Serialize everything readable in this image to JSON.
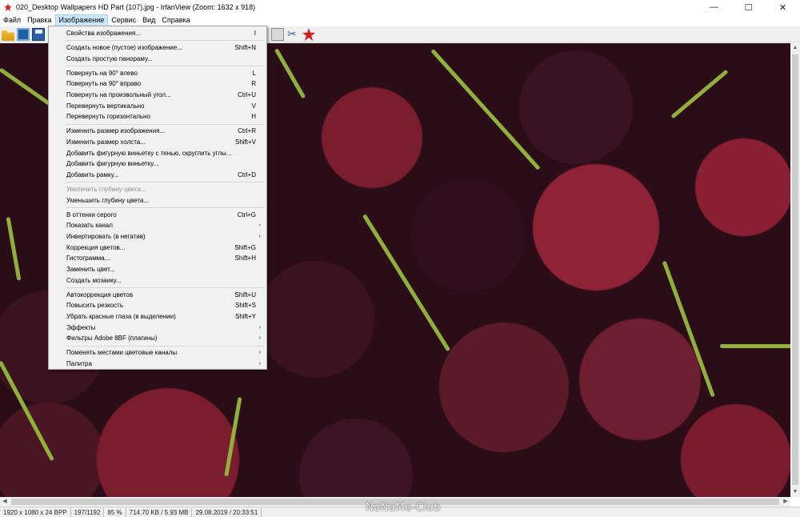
{
  "window": {
    "title": "020_Desktop Wallpapers  HD Part (107).jpg - IrfanView (Zoom: 1632 x 918)",
    "minimize": "—",
    "maximize": "☐",
    "close": "✕"
  },
  "menubar": {
    "items": [
      "Файл",
      "Правка",
      "Изображение",
      "Сервис",
      "Вид",
      "Справка"
    ]
  },
  "dropdown": {
    "items": [
      {
        "label": "Свойства изображения...",
        "shortcut": "I",
        "submenu": false,
        "disabled": false
      },
      {
        "sep": true
      },
      {
        "label": "Создать новое (пустое) изображение...",
        "shortcut": "Shift+N",
        "submenu": false,
        "disabled": false
      },
      {
        "label": "Создать простую панораму...",
        "shortcut": "",
        "submenu": false,
        "disabled": false
      },
      {
        "sep": true
      },
      {
        "label": "Повернуть на 90° влево",
        "shortcut": "L",
        "submenu": false,
        "disabled": false
      },
      {
        "label": "Повернуть на 90° вправо",
        "shortcut": "R",
        "submenu": false,
        "disabled": false
      },
      {
        "label": "Повернуть на произвольный угол...",
        "shortcut": "Ctrl+U",
        "submenu": false,
        "disabled": false
      },
      {
        "label": "Перевернуть вертикально",
        "shortcut": "V",
        "submenu": false,
        "disabled": false
      },
      {
        "label": "Перевернуть горизонтально",
        "shortcut": "H",
        "submenu": false,
        "disabled": false
      },
      {
        "sep": true
      },
      {
        "label": "Изменить размер изображения...",
        "shortcut": "Ctrl+R",
        "submenu": false,
        "disabled": false
      },
      {
        "label": "Изменить размер холста...",
        "shortcut": "Shift+V",
        "submenu": false,
        "disabled": false
      },
      {
        "label": "Добавить фигурную виньетку с тенью, скруглить углы...",
        "shortcut": "",
        "submenu": false,
        "disabled": false
      },
      {
        "label": "Добавить фигурную виньетку...",
        "shortcut": "",
        "submenu": false,
        "disabled": false
      },
      {
        "label": "Добавить рамку...",
        "shortcut": "Ctrl+D",
        "submenu": false,
        "disabled": false
      },
      {
        "sep": true
      },
      {
        "label": "Увеличить глубину цвета...",
        "shortcut": "",
        "submenu": false,
        "disabled": true
      },
      {
        "label": "Уменьшить глубину цвета...",
        "shortcut": "",
        "submenu": false,
        "disabled": false
      },
      {
        "sep": true
      },
      {
        "label": "В оттенки серого",
        "shortcut": "Ctrl+G",
        "submenu": false,
        "disabled": false
      },
      {
        "label": "Показать канал",
        "shortcut": "",
        "submenu": true,
        "disabled": false
      },
      {
        "label": "Инвертировать (в негатив)",
        "shortcut": "",
        "submenu": true,
        "disabled": false
      },
      {
        "label": "Коррекция цветов...",
        "shortcut": "Shift+G",
        "submenu": false,
        "disabled": false
      },
      {
        "label": "Гистограмма...",
        "shortcut": "Shift+H",
        "submenu": false,
        "disabled": false
      },
      {
        "label": "Заменить цвет...",
        "shortcut": "",
        "submenu": false,
        "disabled": false
      },
      {
        "label": "Создать мозаику...",
        "shortcut": "",
        "submenu": false,
        "disabled": false
      },
      {
        "sep": true
      },
      {
        "label": "Автокоррекция цветов",
        "shortcut": "Shift+U",
        "submenu": false,
        "disabled": false
      },
      {
        "label": "Повысить резкость",
        "shortcut": "Shift+S",
        "submenu": false,
        "disabled": false
      },
      {
        "label": "Убрать красные глаза (в выделении)",
        "shortcut": "Shift+Y",
        "submenu": false,
        "disabled": false
      },
      {
        "label": "Эффекты",
        "shortcut": "",
        "submenu": true,
        "disabled": false
      },
      {
        "label": "Фильтры Adobe 8BF (плагины)",
        "shortcut": "",
        "submenu": true,
        "disabled": false
      },
      {
        "sep": true
      },
      {
        "label": "Поменять местами цветовые каналы",
        "shortcut": "",
        "submenu": true,
        "disabled": false
      },
      {
        "label": "Палитра",
        "shortcut": "",
        "submenu": true,
        "disabled": false
      }
    ]
  },
  "statusbar": {
    "cells": [
      "1920 x 1080 x 24 BPP",
      "197/1192",
      "85 %",
      "714.70 KB / 5.93 MB",
      "29.08.2019 / 20:33:51"
    ]
  },
  "watermark": "NoNaMe-Club",
  "icons": {
    "submenu_arrow": "›",
    "scroll_up": "▲",
    "scroll_down": "▼",
    "scroll_left": "◀",
    "scroll_right": "▶"
  }
}
